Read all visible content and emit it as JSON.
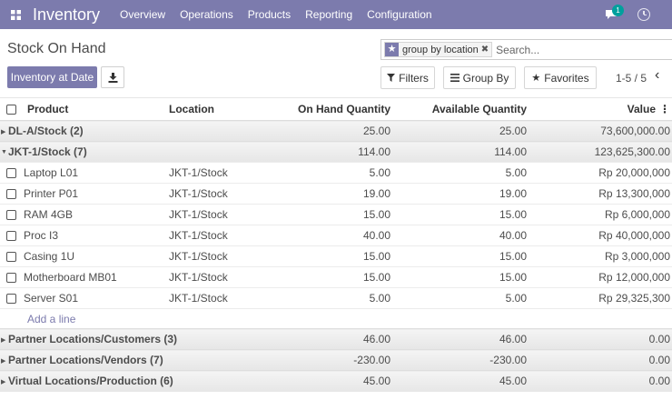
{
  "navbar": {
    "brand": "Inventory",
    "menu": [
      "Overview",
      "Operations",
      "Products",
      "Reporting",
      "Configuration"
    ],
    "message_count": "1",
    "accent_color": "#7c7bad"
  },
  "control_panel": {
    "title": "Stock On Hand",
    "search": {
      "facet_label": "group by location",
      "placeholder": "Search..."
    },
    "inventory_at_date_label": "Inventory at Date",
    "filters_label": "Filters",
    "group_by_label": "Group By",
    "favorites_label": "Favorites",
    "pager": "1-5 / 5"
  },
  "table": {
    "columns": {
      "product": "Product",
      "location": "Location",
      "on_hand": "On Hand Quantity",
      "available": "Available Quantity",
      "value": "Value"
    },
    "groups": [
      {
        "name": "DL-A/Stock (2)",
        "on_hand": "25.00",
        "available": "25.00",
        "value": "73,600,000.00"
      },
      {
        "name": "JKT-1/Stock (7)",
        "on_hand": "114.00",
        "available": "114.00",
        "value": "123,625,300.00"
      },
      {
        "name": "Partner Locations/Customers (3)",
        "on_hand": "46.00",
        "available": "46.00",
        "value": "0.00"
      },
      {
        "name": "Partner Locations/Vendors (7)",
        "on_hand": "-230.00",
        "available": "-230.00",
        "value": "0.00"
      },
      {
        "name": "Virtual Locations/Production (6)",
        "on_hand": "45.00",
        "available": "45.00",
        "value": "0.00"
      }
    ],
    "rows": [
      {
        "product": "Laptop L01",
        "location": "JKT-1/Stock",
        "on_hand": "5.00",
        "available": "5.00",
        "value": "Rp 20,000,000"
      },
      {
        "product": "Printer P01",
        "location": "JKT-1/Stock",
        "on_hand": "19.00",
        "available": "19.00",
        "value": "Rp 13,300,000"
      },
      {
        "product": "RAM 4GB",
        "location": "JKT-1/Stock",
        "on_hand": "15.00",
        "available": "15.00",
        "value": "Rp 6,000,000"
      },
      {
        "product": "Proc I3",
        "location": "JKT-1/Stock",
        "on_hand": "40.00",
        "available": "40.00",
        "value": "Rp 40,000,000"
      },
      {
        "product": "Casing 1U",
        "location": "JKT-1/Stock",
        "on_hand": "15.00",
        "available": "15.00",
        "value": "Rp 3,000,000"
      },
      {
        "product": "Motherboard MB01",
        "location": "JKT-1/Stock",
        "on_hand": "15.00",
        "available": "15.00",
        "value": "Rp 12,000,000"
      },
      {
        "product": "Server S01",
        "location": "JKT-1/Stock",
        "on_hand": "5.00",
        "available": "5.00",
        "value": "Rp 29,325,300"
      }
    ],
    "add_line_label": "Add a line"
  }
}
